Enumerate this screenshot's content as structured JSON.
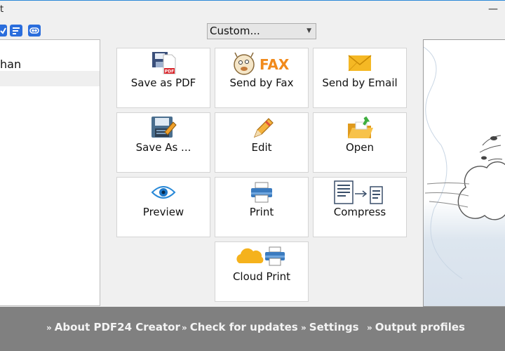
{
  "window": {
    "title_fragment": "t",
    "minimize_glyph": "—"
  },
  "toolbar": {
    "icons": [
      "check-icon",
      "list-icon",
      "toggle-icon"
    ]
  },
  "left_panel": {
    "items": [
      {
        "label": "han"
      }
    ]
  },
  "profile_select": {
    "value": "Custom...",
    "arrow_glyph": "▼"
  },
  "actions": {
    "save_as_pdf": "Save as PDF",
    "send_by_fax": "Send by Fax",
    "send_by_email": "Send by Email",
    "save_as": "Save As ...",
    "edit": "Edit",
    "open": "Open",
    "preview": "Preview",
    "print": "Print",
    "compress": "Compress",
    "cloud_print": "Cloud Print"
  },
  "icons": {
    "pdf_badge": "PDF",
    "fax_text": "FAX"
  },
  "colors": {
    "accent_blue": "#2a6ddc",
    "fax_orange": "#f18a1c",
    "email_yellow": "#f5b824",
    "bottom_bar": "#808080"
  },
  "bottom_bar": {
    "chevron": "»",
    "links": {
      "about": "About PDF24 Creator",
      "updates": "Check for updates",
      "settings": "Settings",
      "profiles": "Output profiles"
    }
  }
}
